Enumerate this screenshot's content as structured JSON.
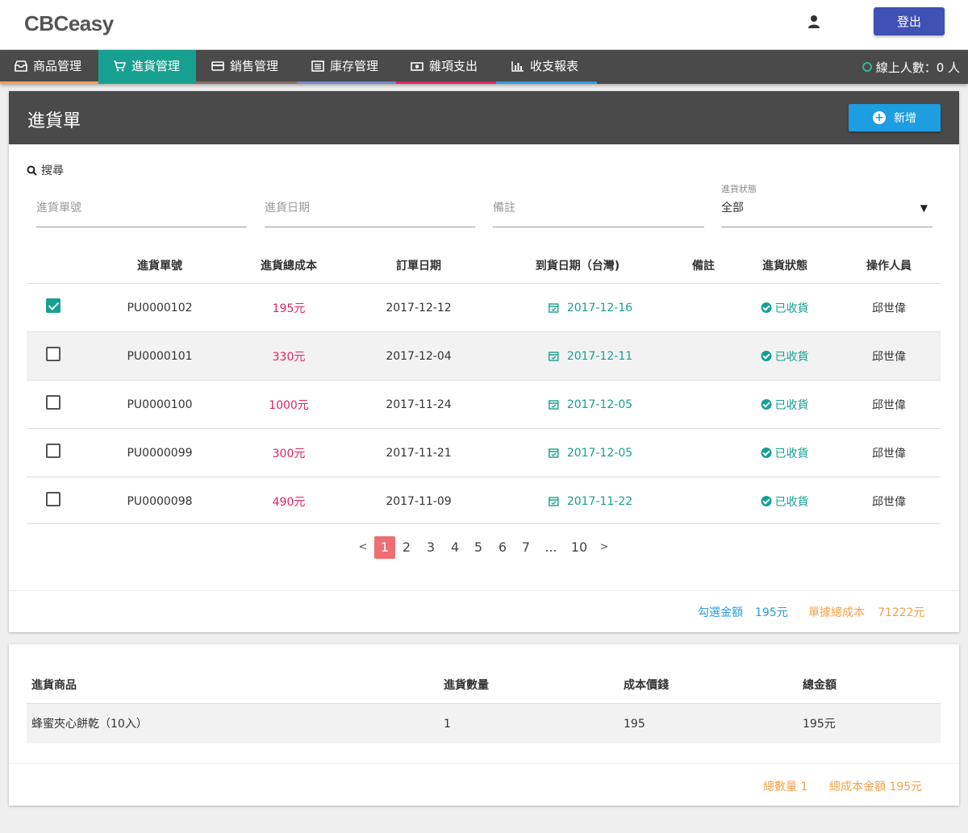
{
  "header": {
    "logo": "CBCeasy",
    "logout_label": "登出",
    "user_icon": "user-icon"
  },
  "nav": {
    "items": [
      {
        "label": "商品管理",
        "icon": "box-icon",
        "accent": "#f3a14b"
      },
      {
        "label": "進貨管理",
        "icon": "cart-icon",
        "accent": "#17a090",
        "active": true
      },
      {
        "label": "銷售管理",
        "icon": "card-icon",
        "accent": "#8d6e63"
      },
      {
        "label": "庫存管理",
        "icon": "list-icon",
        "accent": "#7986cb"
      },
      {
        "label": "雜項支出",
        "icon": "money-icon",
        "accent": "#e0245e"
      },
      {
        "label": "收支報表",
        "icon": "bar-chart-icon",
        "accent": "#2b9ee0"
      }
    ],
    "online": "線上人數：0 人"
  },
  "purchase": {
    "title": "進貨單",
    "add_label": "新增",
    "search_label": "搜尋",
    "filters": {
      "order_no_placeholder": "進貨單號",
      "date_placeholder": "進貨日期",
      "note_placeholder": "備註",
      "status_label": "進貨狀態",
      "status_value": "全部"
    },
    "columns": [
      "進貨單號",
      "進貨總成本",
      "訂單日期",
      "到貨日期（台灣)",
      "備註",
      "進貨狀態",
      "操作人員"
    ],
    "rows": [
      {
        "checked": true,
        "id": "PU0000102",
        "cost": "195元",
        "order_date": "2017-12-12",
        "arrival": "2017-12-16",
        "note": "",
        "status": "已收貨",
        "operator": "邱世偉"
      },
      {
        "checked": false,
        "id": "PU0000101",
        "cost": "330元",
        "order_date": "2017-12-04",
        "arrival": "2017-12-11",
        "note": "",
        "status": "已收貨",
        "operator": "邱世偉"
      },
      {
        "checked": false,
        "id": "PU0000100",
        "cost": "1000元",
        "order_date": "2017-11-24",
        "arrival": "2017-12-05",
        "note": "",
        "status": "已收貨",
        "operator": "邱世偉"
      },
      {
        "checked": false,
        "id": "PU0000099",
        "cost": "300元",
        "order_date": "2017-11-21",
        "arrival": "2017-12-05",
        "note": "",
        "status": "已收貨",
        "operator": "邱世偉"
      },
      {
        "checked": false,
        "id": "PU0000098",
        "cost": "490元",
        "order_date": "2017-11-09",
        "arrival": "2017-11-22",
        "note": "",
        "status": "已收貨",
        "operator": "邱世偉"
      }
    ],
    "pagination": {
      "prev": "<",
      "pages": [
        "1",
        "2",
        "3",
        "4",
        "5",
        "6",
        "7",
        "...",
        "10"
      ],
      "current": "1",
      "next": ">"
    },
    "summary": {
      "selected_label": "勾選金額",
      "selected_value": "195元",
      "total_label": "單據總成本",
      "total_value": "71222元"
    }
  },
  "detail": {
    "columns": [
      "進貨商品",
      "進貨數量",
      "成本價錢",
      "總金額"
    ],
    "rows": [
      {
        "product": "蜂蜜夾心餅乾（10入）",
        "qty": "1",
        "unit_cost": "195",
        "total": "195元"
      }
    ],
    "summary": {
      "qty": "總數量 1",
      "amount": "總成本金額 195元"
    }
  },
  "colors": {
    "primary": "#3f51b5",
    "teal": "#17a090",
    "blue": "#2b9ee0",
    "red": "#e0245e",
    "orange": "#f3a14b",
    "nav_bg": "#4a4a4a"
  }
}
